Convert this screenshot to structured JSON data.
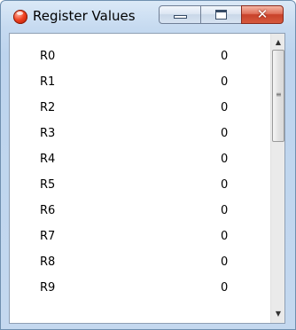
{
  "window": {
    "title": "Register Values",
    "icon": "red-sphere-icon",
    "controls": {
      "minimize": "minimize-icon",
      "maximize": "maximize-icon",
      "close": "✕"
    }
  },
  "registers": [
    {
      "name": "R0",
      "value": "0"
    },
    {
      "name": "R1",
      "value": "0"
    },
    {
      "name": "R2",
      "value": "0"
    },
    {
      "name": "R3",
      "value": "0"
    },
    {
      "name": "R4",
      "value": "0"
    },
    {
      "name": "R5",
      "value": "0"
    },
    {
      "name": "R6",
      "value": "0"
    },
    {
      "name": "R7",
      "value": "0"
    },
    {
      "name": "R8",
      "value": "0"
    },
    {
      "name": "R9",
      "value": "0"
    }
  ],
  "scrollbar": {
    "up_arrow": "▲",
    "down_arrow": "▼",
    "grip": "≡"
  }
}
